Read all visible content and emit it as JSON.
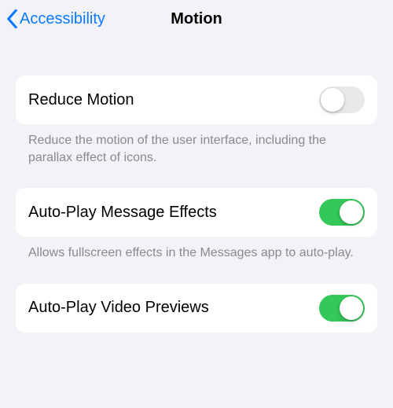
{
  "nav": {
    "back_label": "Accessibility",
    "title": "Motion"
  },
  "settings": {
    "reduce_motion": {
      "label": "Reduce Motion",
      "enabled": false,
      "footer": "Reduce the motion of the user interface, including the parallax effect of icons."
    },
    "autoplay_message_effects": {
      "label": "Auto-Play Message Effects",
      "enabled": true,
      "footer": "Allows fullscreen effects in the Messages app to auto-play."
    },
    "autoplay_video_previews": {
      "label": "Auto-Play Video Previews",
      "enabled": true
    }
  },
  "colors": {
    "accent_blue": "#0a7aff",
    "switch_green": "#34c759",
    "background": "#f2f2f7",
    "row_background": "#ffffff",
    "footer_text": "#8a8a8e"
  }
}
